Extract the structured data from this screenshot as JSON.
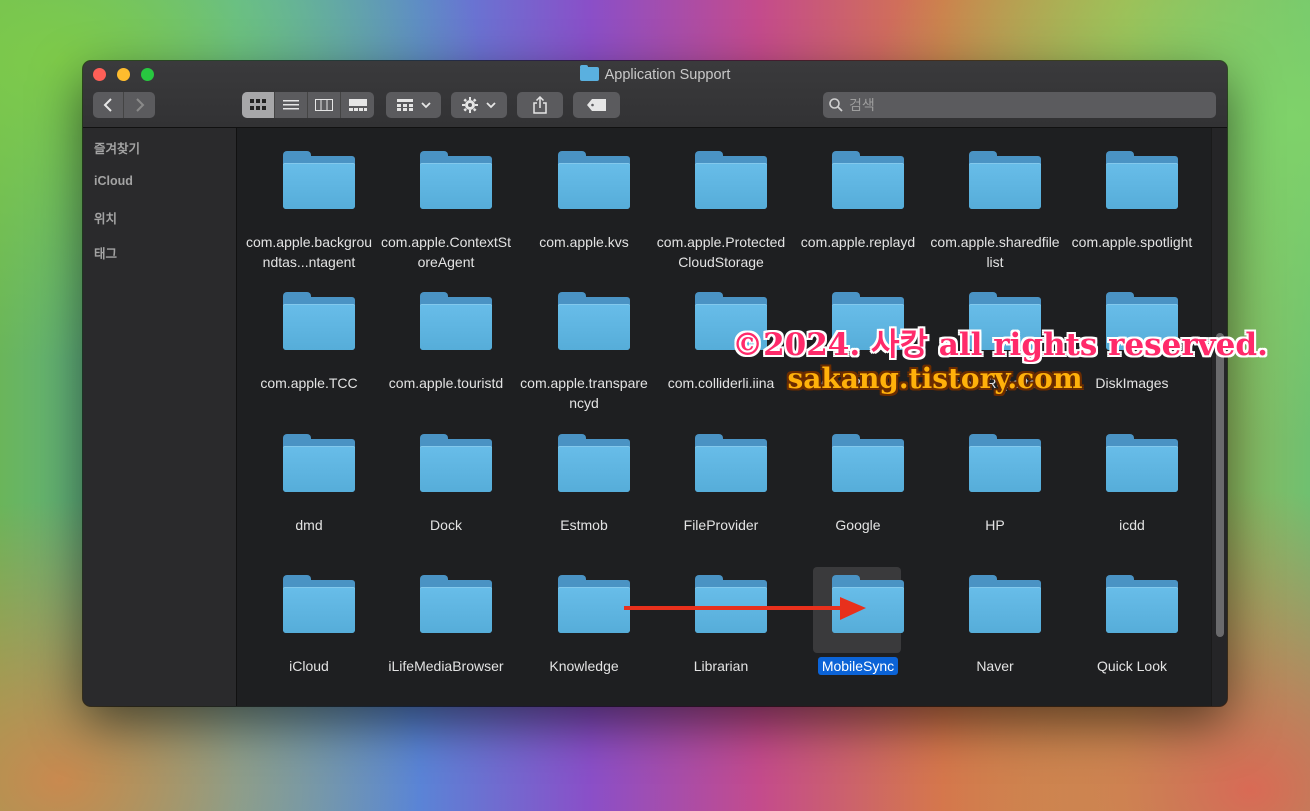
{
  "window": {
    "title": "Application Support"
  },
  "toolbar": {
    "back_label": "‹",
    "forward_label": "›",
    "view_modes": [
      "icon-view",
      "list-view",
      "column-view",
      "gallery-view"
    ],
    "active_view": "icon-view"
  },
  "search": {
    "placeholder": "검색"
  },
  "sidebar": {
    "sections": [
      {
        "label": "즐겨찾기"
      },
      {
        "label": "iCloud"
      },
      {
        "label": "위치"
      },
      {
        "label": "태그"
      }
    ]
  },
  "folders": [
    {
      "label": "com.apple.backgroundtas...ntagent"
    },
    {
      "label": "com.apple.ContextStoreAgent"
    },
    {
      "label": "com.apple.kvs"
    },
    {
      "label": "com.apple.ProtectedCloudStorage"
    },
    {
      "label": "com.apple.replayd"
    },
    {
      "label": "com.apple.sharedfilelist"
    },
    {
      "label": "com.apple.spotlight"
    },
    {
      "label": "com.apple.TCC"
    },
    {
      "label": "com.apple.touristd"
    },
    {
      "label": "com.apple.transparencyd"
    },
    {
      "label": "com.colliderli.iina"
    },
    {
      "label": "CoreParsec"
    },
    {
      "label": "CrashReporter"
    },
    {
      "label": "DiskImages"
    },
    {
      "label": "dmd"
    },
    {
      "label": "Dock"
    },
    {
      "label": "Estmob"
    },
    {
      "label": "FileProvider"
    },
    {
      "label": "Google"
    },
    {
      "label": "HP"
    },
    {
      "label": "icdd"
    },
    {
      "label": "iCloud"
    },
    {
      "label": "iLifeMediaBrowser"
    },
    {
      "label": "Knowledge"
    },
    {
      "label": "Librarian"
    },
    {
      "label": "MobileSync",
      "selected": true
    },
    {
      "label": "Naver"
    },
    {
      "label": "Quick Look"
    }
  ],
  "watermark": {
    "line1": "©2024. 사캉 all rights reserved.",
    "line2": "sakang.tistory.com"
  },
  "colors": {
    "selection": "#0b63d7",
    "folder": "#5ab0df",
    "arrow": "#e8301c",
    "watermark_line1": "#ff2a6a",
    "watermark_line2": "#ffb10a"
  }
}
